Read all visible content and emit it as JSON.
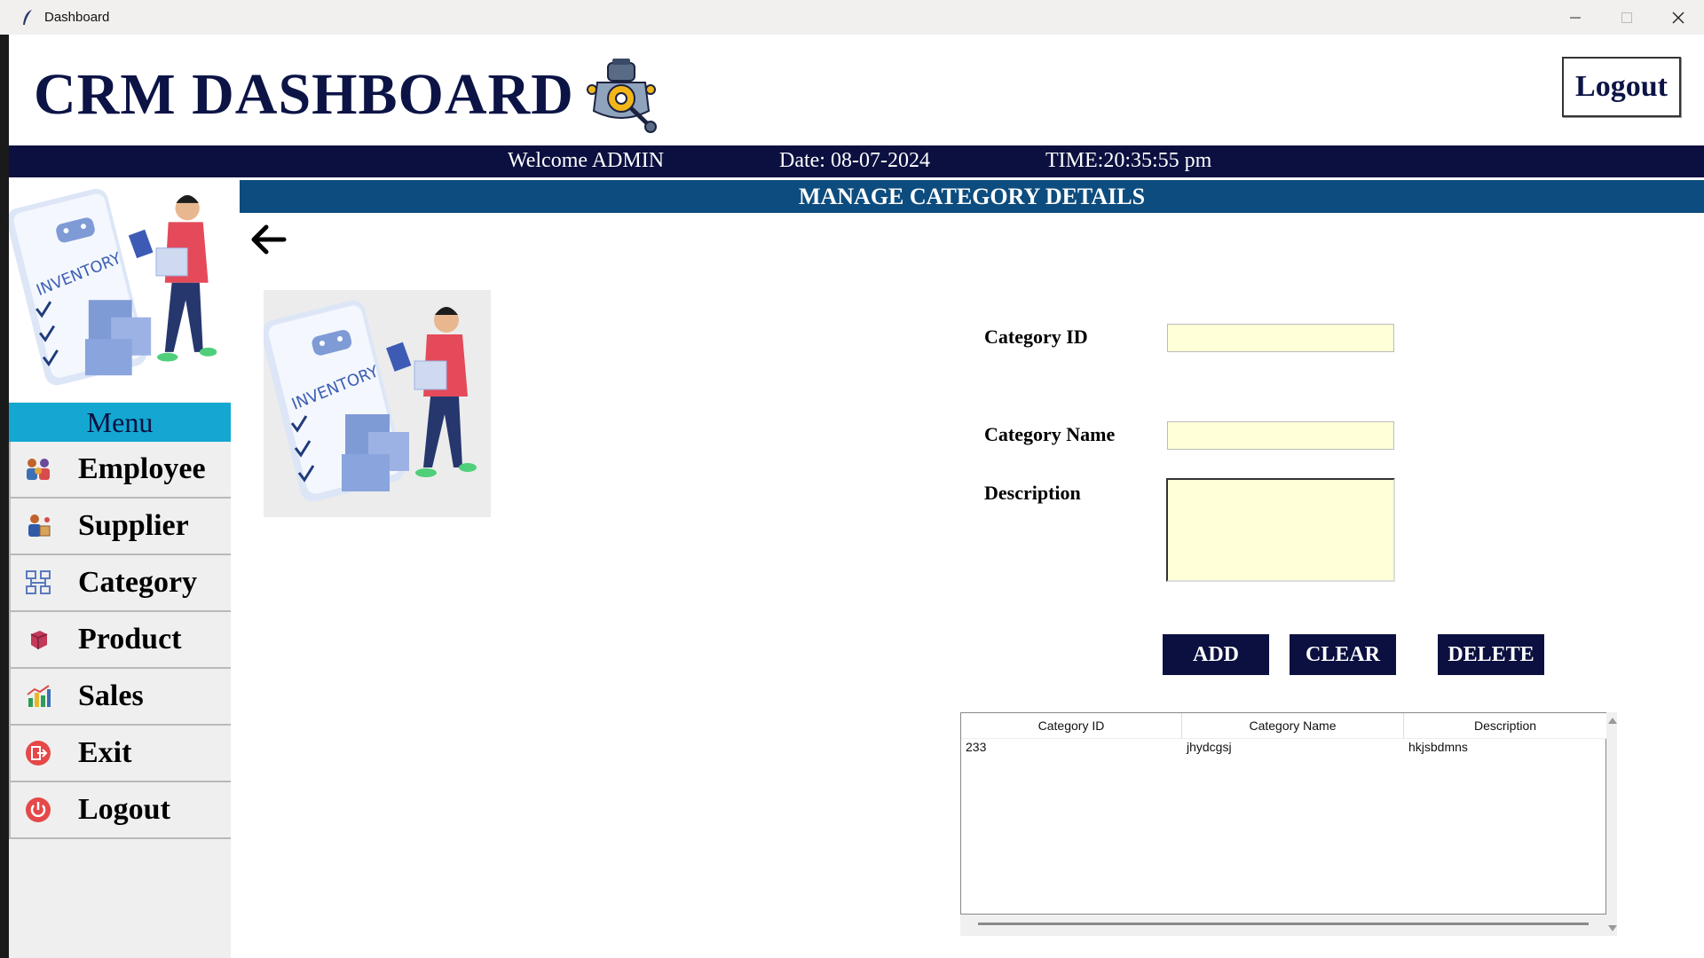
{
  "window": {
    "title": "Dashboard"
  },
  "header": {
    "title": "CRM DASHBOARD",
    "logout_label": "Logout"
  },
  "infobar": {
    "welcome": "Welcome ADMIN",
    "date": "Date: 08-07-2024",
    "time": "TIME:20:35:55 pm"
  },
  "sidebar": {
    "menu_title": "Menu",
    "illustration_text": "INVENTORY",
    "items": [
      {
        "label": "Employee",
        "icon": "employee-icon"
      },
      {
        "label": "Supplier",
        "icon": "supplier-icon"
      },
      {
        "label": "Category",
        "icon": "category-icon"
      },
      {
        "label": "Product",
        "icon": "product-icon"
      },
      {
        "label": "Sales",
        "icon": "sales-icon"
      },
      {
        "label": "Exit",
        "icon": "exit-icon"
      },
      {
        "label": "Logout",
        "icon": "power-icon"
      }
    ]
  },
  "main": {
    "section_title": "MANAGE CATEGORY DETAILS",
    "illustration_text": "INVENTORY",
    "form": {
      "category_id_label": "Category ID",
      "category_id_value": "",
      "category_name_label": "Category Name",
      "category_name_value": "",
      "description_label": "Description",
      "description_value": ""
    },
    "buttons": {
      "add": "ADD",
      "clear": "CLEAR",
      "delete": "DELETE"
    },
    "table": {
      "columns": [
        "Category ID",
        "Category Name",
        "Description"
      ],
      "rows": [
        [
          "233",
          "jhydcgsj",
          "hkjsbdmns"
        ]
      ]
    }
  },
  "colors": {
    "navy": "#0b1040",
    "section_blue": "#0d4c7e",
    "menu_cyan": "#13a7d1",
    "input_yellow": "#ffffd8"
  }
}
